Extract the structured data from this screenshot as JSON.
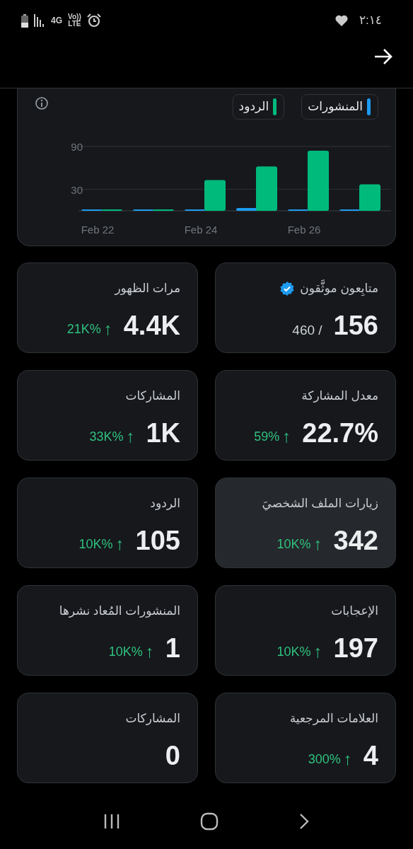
{
  "status_bar": {
    "network": "4G",
    "voice": "Vo))",
    "lte": "LTE",
    "time": "٢:١٤"
  },
  "chart": {
    "chart_data": {
      "type": "bar",
      "categories": [
        "Feb 22",
        null,
        "Feb 24",
        null,
        "Feb 26",
        null
      ],
      "series": [
        {
          "name": "المنشورات",
          "color": "#1d9bf0",
          "values": [
            0,
            0,
            1,
            4,
            1,
            2
          ]
        },
        {
          "name": "الردود",
          "color": "#00ba7c",
          "values": [
            1,
            0,
            43,
            62,
            84,
            37
          ]
        }
      ],
      "yticks": [
        30,
        90
      ],
      "ylim": [
        0,
        90
      ]
    }
  },
  "metrics": [
    {
      "title": "متابِعون موثَّقون",
      "verified": true,
      "value": "156",
      "secondary": "/ 460",
      "selected": false
    },
    {
      "title": "مرات الظهور",
      "verified": false,
      "value": "4.4K",
      "change": "21K%",
      "arrow": "↑",
      "selected": false
    },
    {
      "title": "معدل المشاركة",
      "verified": false,
      "value": "22.7%",
      "change": "59%",
      "arrow": "↑",
      "selected": false
    },
    {
      "title": "المشاركات",
      "verified": false,
      "value": "1K",
      "change": "33K%",
      "arrow": "↑",
      "selected": false
    },
    {
      "title": "زيارات الملف الشخصيَ",
      "verified": false,
      "value": "342",
      "change": "10K%",
      "arrow": "↑",
      "selected": true
    },
    {
      "title": "الردود",
      "verified": false,
      "value": "105",
      "change": "10K%",
      "arrow": "↑",
      "selected": false
    },
    {
      "title": "الإعجابات",
      "verified": false,
      "value": "197",
      "change": "10K%",
      "arrow": "↑",
      "selected": false
    },
    {
      "title": "المنشورات المُعاد نشرها",
      "verified": false,
      "value": "1",
      "change": "10K%",
      "arrow": "↑",
      "selected": false
    },
    {
      "title": "العلامات المرجعية",
      "verified": false,
      "value": "4",
      "change": "300%",
      "arrow": "↑",
      "selected": false
    },
    {
      "title": "المشاركات",
      "verified": false,
      "value": "0",
      "selected": false
    }
  ]
}
